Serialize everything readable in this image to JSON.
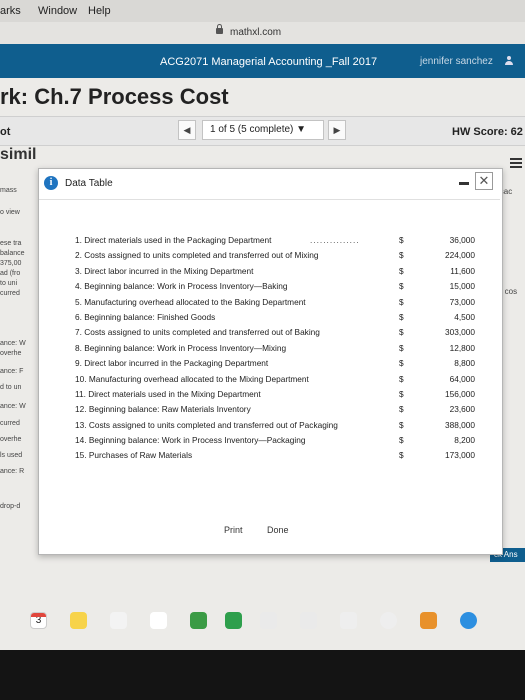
{
  "menubar": {
    "items": [
      "arks",
      "Window",
      "Help"
    ]
  },
  "browser": {
    "url": "mathxl.com"
  },
  "banner": {
    "course": "ACG2071 Managerial Accounting _Fall 2017",
    "user": "jennifer sanchez"
  },
  "page_title": "rk: Ch.7 Process Cost",
  "question_bar": {
    "left_text": "ot",
    "counter": "1 of 5 (5 complete) ▼",
    "score": "HW Score: 62"
  },
  "similar_text": "simil",
  "background_left": [
    "mass",
    "o view",
    "ese tra",
    "balance",
    "375,00",
    "ad (fro",
    "to uni",
    "curred",
    "ance: W",
    "overhe",
    "ance: F",
    "d to un",
    "ance: W",
    "curred",
    "overhe",
    "ls used",
    "ance: R",
    "drop-d"
  ],
  "background_right": [
    "isac",
    "e cos"
  ],
  "answer_bar": "ck Ans",
  "modal": {
    "title": "Data Table",
    "rows": [
      {
        "label": "1. Direct materials used in the Packaging Department",
        "dollar": "$",
        "amount": "36,000"
      },
      {
        "label": "2. Costs assigned to units completed and transferred out of Mixing",
        "dollar": "$",
        "amount": "224,000"
      },
      {
        "label": "3. Direct labor incurred in the Mixing Department",
        "dollar": "$",
        "amount": "11,600"
      },
      {
        "label": "4. Beginning balance: Work in Process Inventory—Baking",
        "dollar": "$",
        "amount": "15,000"
      },
      {
        "label": "5. Manufacturing overhead allocated to the Baking Department",
        "dollar": "$",
        "amount": "73,000"
      },
      {
        "label": "6. Beginning balance: Finished Goods",
        "dollar": "$",
        "amount": "4,500"
      },
      {
        "label": "7. Costs assigned to units completed and transferred out of Baking",
        "dollar": "$",
        "amount": "303,000"
      },
      {
        "label": "8. Beginning balance: Work in Process Inventory—Mixing",
        "dollar": "$",
        "amount": "12,800"
      },
      {
        "label": "9. Direct labor incurred in the Packaging Department",
        "dollar": "$",
        "amount": "8,800"
      },
      {
        "label": "10. Manufacturing overhead allocated to the Mixing Department",
        "dollar": "$",
        "amount": "64,000"
      },
      {
        "label": "11. Direct materials used in the Mixing Department",
        "dollar": "$",
        "amount": "156,000"
      },
      {
        "label": "12. Beginning balance: Raw Materials Inventory",
        "dollar": "$",
        "amount": "23,600"
      },
      {
        "label": "13. Costs assigned to units completed and transferred out of Packaging",
        "dollar": "$",
        "amount": "388,000"
      },
      {
        "label": "14. Beginning balance: Work in Process Inventory—Packaging",
        "dollar": "$",
        "amount": "8,200"
      },
      {
        "label": "15. Purchases of Raw Materials",
        "dollar": "$",
        "amount": "173,000"
      }
    ],
    "print_label": "Print",
    "done_label": "Done"
  },
  "dock": {
    "calendar_day": "3"
  }
}
